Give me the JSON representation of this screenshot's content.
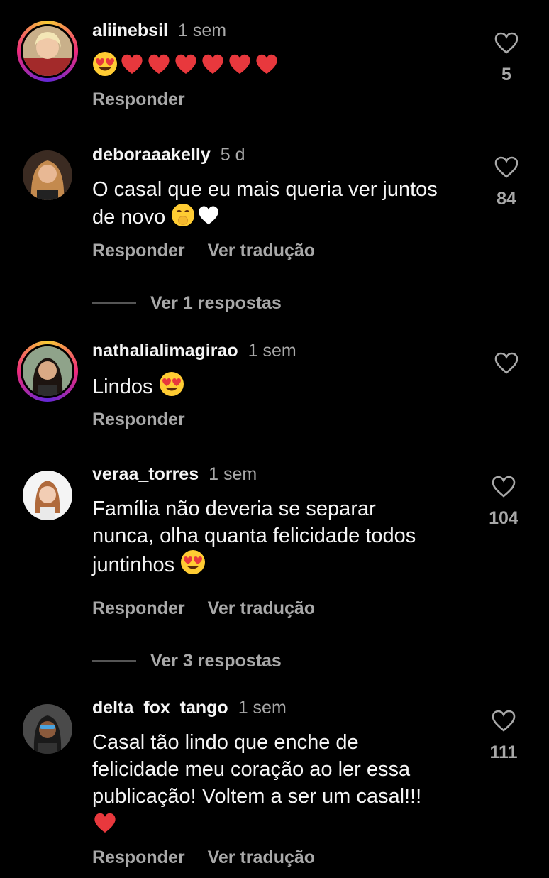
{
  "comments": [
    {
      "username": "aliinebsil",
      "time": "1 sem",
      "text": "",
      "emojis": [
        "heart-eyes-emoji",
        "red-heart-emoji",
        "red-heart-emoji",
        "red-heart-emoji",
        "red-heart-emoji",
        "red-heart-emoji",
        "red-heart-emoji"
      ],
      "reply_label": "Responder",
      "translate_label": "",
      "likes": "5"
    },
    {
      "username": "deboraaakelly",
      "time": "5 d",
      "text_line1": "O casal que eu mais queria ver juntos",
      "text_line2": "de novo",
      "emojis": [
        "hand-over-mouth-emoji",
        "white-heart-emoji"
      ],
      "reply_label": "Responder",
      "translate_label": "Ver tradução",
      "likes": "84",
      "view_replies": "Ver 1 respostas"
    },
    {
      "username": "nathalialimagirao",
      "time": "1 sem",
      "text": "Lindos",
      "emojis": [
        "heart-eyes-emoji"
      ],
      "reply_label": "Responder",
      "translate_label": "",
      "likes": ""
    },
    {
      "username": "veraa_torres",
      "time": "1 sem",
      "text_line1": "Família não deveria se separar",
      "text_line2": "nunca, olha quanta felicidade todos",
      "text_line3": "juntinhos",
      "emojis": [
        "heart-eyes-emoji"
      ],
      "reply_label": "Responder",
      "translate_label": "Ver tradução",
      "likes": "104",
      "view_replies": "Ver 3 respostas"
    },
    {
      "username": "delta_fox_tango",
      "time": "1 sem",
      "text_line1": "Casal tão lindo que enche de",
      "text_line2": "felicidade meu coração ao ler essa",
      "text_line3": "publicação! Voltem a ser um casal!!!",
      "emojis": [
        "red-heart-emoji"
      ],
      "reply_label": "Responder",
      "translate_label": "Ver tradução",
      "likes": "111"
    }
  ],
  "colors": {
    "background": "#000000",
    "primary_text": "#f5f5f5",
    "secondary_text": "#a8a8a8",
    "heart_red": "#e8383d",
    "emoji_yellow": "#ffcc33"
  }
}
